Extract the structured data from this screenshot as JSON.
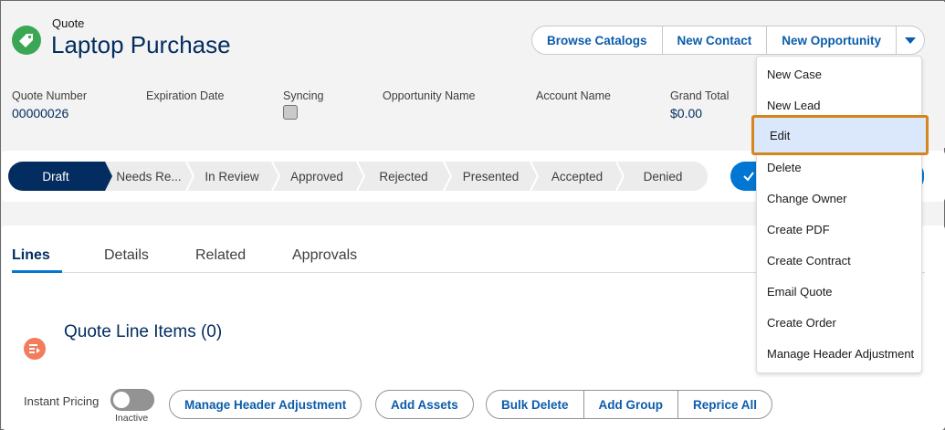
{
  "header": {
    "record_type": "Quote",
    "title": "Laptop Purchase",
    "icon": "quote-tag-icon",
    "actions": {
      "browse_catalogs": "Browse Catalogs",
      "new_contact": "New Contact",
      "new_opportunity": "New Opportunity"
    }
  },
  "fields": [
    {
      "label": "Quote Number",
      "value": "00000026"
    },
    {
      "label": "Expiration Date",
      "value": ""
    },
    {
      "label": "Syncing",
      "value": ""
    },
    {
      "label": "Opportunity Name",
      "value": ""
    },
    {
      "label": "Account Name",
      "value": ""
    },
    {
      "label": "Grand Total",
      "value": "$0.00"
    }
  ],
  "path": {
    "stages": [
      "Draft",
      "Needs Re...",
      "In Review",
      "Approved",
      "Rejected",
      "Presented",
      "Accepted",
      "Denied"
    ],
    "active_index": 0
  },
  "tabs": [
    "Lines",
    "Details",
    "Related",
    "Approvals"
  ],
  "lines": {
    "section_title": "Quote Line Items (0)",
    "instant_pricing_label": "Instant Pricing",
    "toggle_state": "Inactive",
    "buttons": {
      "manage_header_adjustment": "Manage Header Adjustment",
      "add_assets": "Add Assets",
      "bulk_delete": "Bulk Delete",
      "add_group": "Add Group",
      "reprice_all": "Reprice All"
    }
  },
  "menu": {
    "items": [
      "New Case",
      "New Lead",
      "Edit",
      "Delete",
      "Change Owner",
      "Create PDF",
      "Create Contract",
      "Email Quote",
      "Create Order",
      "Manage Header Adjustment"
    ],
    "highlighted_index": 2
  },
  "colors": {
    "brand_blue": "#0176d3",
    "title_navy": "#032d60",
    "quote_icon_green": "#3ba755",
    "quote_lines_icon_orange": "#f27c5c",
    "highlight_outline": "#d4861d"
  }
}
